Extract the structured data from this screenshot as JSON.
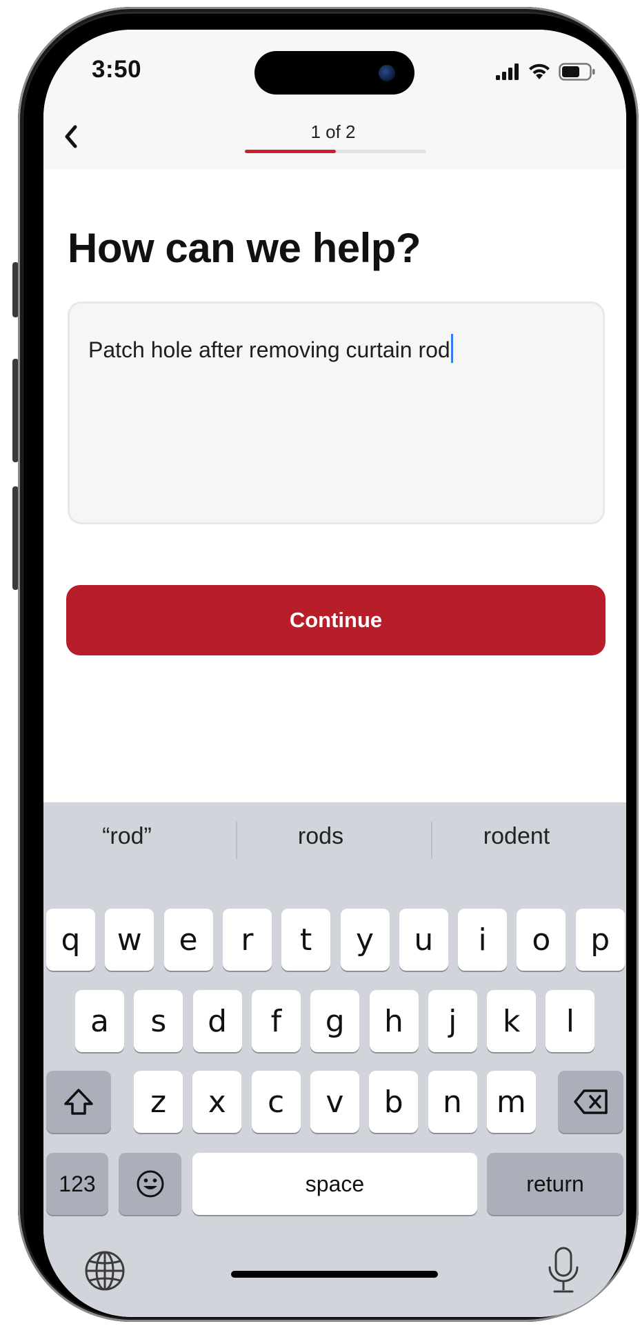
{
  "status_bar": {
    "time": "3:50"
  },
  "nav": {
    "step_label": "1 of 2",
    "progress": 0.5
  },
  "heading": "How can we help?",
  "description_field": {
    "value": "Patch hole after removing curtain rod"
  },
  "continue_button": {
    "label": "Continue"
  },
  "keyboard": {
    "suggestions": [
      "“rod”",
      "rods",
      "rodent"
    ],
    "row1": [
      "q",
      "w",
      "e",
      "r",
      "t",
      "y",
      "u",
      "i",
      "o",
      "p"
    ],
    "row2": [
      "a",
      "s",
      "d",
      "f",
      "g",
      "h",
      "j",
      "k",
      "l"
    ],
    "row3": [
      "z",
      "x",
      "c",
      "v",
      "b",
      "n",
      "m"
    ],
    "numbers_label": "123",
    "space_label": "space",
    "return_label": "return"
  },
  "colors": {
    "accent": "#b71e29",
    "keyboard_bg": "#d1d4db",
    "caret": "#2f7cf6"
  },
  "icons": [
    "back-chevron-icon",
    "signal-icon",
    "wifi-icon",
    "battery-icon",
    "shift-icon",
    "delete-icon",
    "emoji-icon",
    "globe-icon",
    "microphone-icon"
  ]
}
